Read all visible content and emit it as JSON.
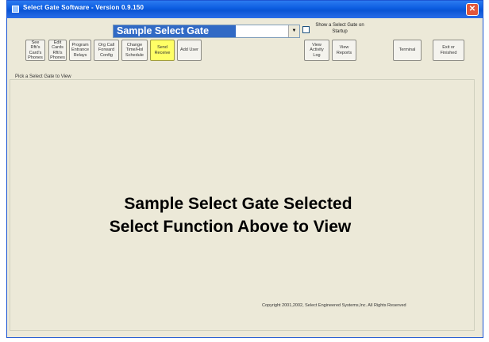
{
  "window": {
    "title": "Select Gate Software - Version 0.9.150",
    "close_glyph": "✕"
  },
  "gate_select": {
    "value": "Sample Select Gate",
    "arrow": "▼"
  },
  "startup_option": {
    "label": "Show a Select Gate on Startup",
    "checked": false
  },
  "toolbar": [
    {
      "label": "See Rfti's\nCard's\nPhones",
      "name": "see-rfids-cards-phones-button",
      "highlight": false
    },
    {
      "label": "Edit Cards\nRfti's\nPhones",
      "name": "edit-cards-rfids-phones-button",
      "highlight": false
    },
    {
      "label": "Program\nEntrance\nRelays",
      "name": "program-entrance-relays-button",
      "highlight": false
    },
    {
      "label": "Org Call\nForward\nConfig",
      "name": "org-call-forward-config-button",
      "highlight": false
    },
    {
      "label": "Change\nTime/Hol\nSchedule",
      "name": "change-time-hol-schedule-button",
      "highlight": false
    },
    {
      "label": "Send\nReceive",
      "name": "send-receive-button",
      "highlight": true
    },
    {
      "label": "Add User",
      "name": "add-user-button",
      "highlight": false
    },
    {
      "label": "View\nActivity\nLog",
      "name": "view-activity-log-button",
      "highlight": false
    },
    {
      "label": "View\nReports",
      "name": "view-reports-button",
      "highlight": false
    },
    {
      "label": "Terminal",
      "name": "terminal-button",
      "highlight": false
    },
    {
      "label": "Exit or\nFinished",
      "name": "exit-button",
      "highlight": false
    }
  ],
  "panel": {
    "group_label": "Pick a Select Gate to View",
    "message_line1": "Sample Select Gate Selected",
    "message_line2": "Select Function Above to View"
  },
  "footer": {
    "copyright": "Copyright 2001,2002,  Select Engineered Systems,Inc. All Rights Reserved"
  }
}
